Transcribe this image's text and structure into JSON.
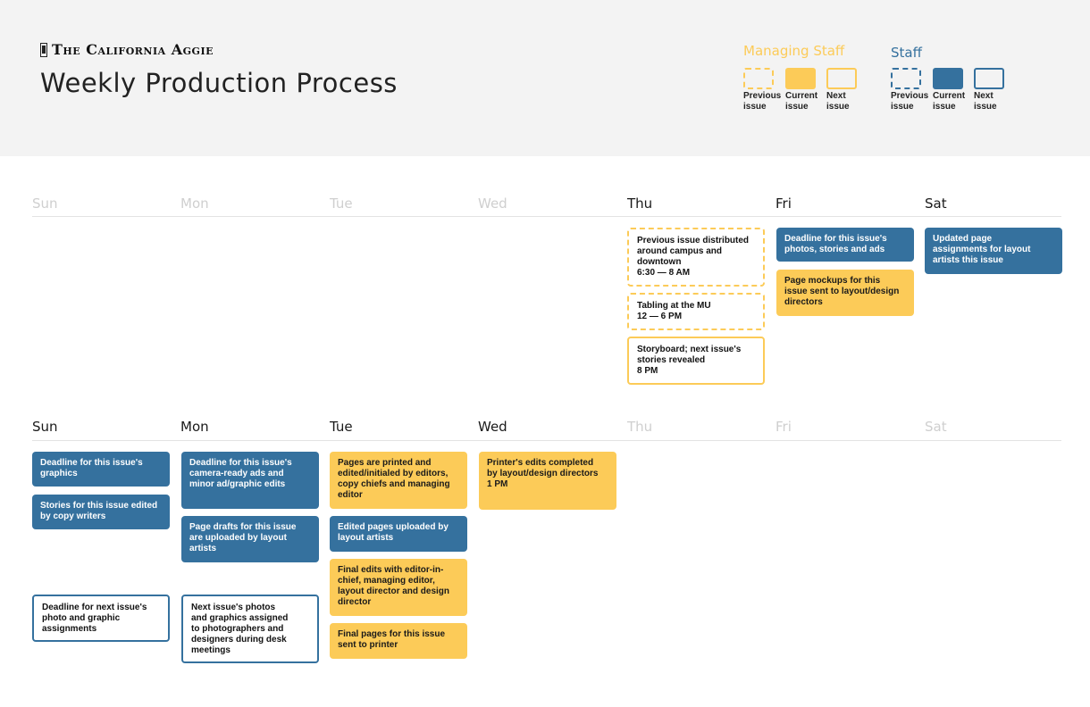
{
  "header": {
    "publication": "The California Aggie",
    "title": "Weekly Production Process"
  },
  "legend": {
    "managing": {
      "title": "Managing Staff",
      "color": "#fccb58",
      "items": [
        "Previous\nissue",
        "Current\nissue",
        "Next\nissue"
      ]
    },
    "staff": {
      "title": "Staff",
      "color": "#35719e",
      "items": [
        "Previous\nissue",
        "Current\nissue",
        "Next\nissue"
      ]
    }
  },
  "weeks": [
    {
      "days": [
        {
          "label": "Sun",
          "active": false
        },
        {
          "label": "Mon",
          "active": false
        },
        {
          "label": "Tue",
          "active": false
        },
        {
          "label": "Wed",
          "active": false
        },
        {
          "label": "Thu",
          "active": true
        },
        {
          "label": "Fri",
          "active": true
        },
        {
          "label": "Sat",
          "active": true
        }
      ]
    },
    {
      "days": [
        {
          "label": "Sun",
          "active": true
        },
        {
          "label": "Mon",
          "active": true
        },
        {
          "label": "Tue",
          "active": true
        },
        {
          "label": "Wed",
          "active": true
        },
        {
          "label": "Thu",
          "active": false
        },
        {
          "label": "Fri",
          "active": false
        },
        {
          "label": "Sat",
          "active": false
        }
      ]
    }
  ],
  "tasks": {
    "thu_1": "Previous issue distributed\naround campus and\ndowntown\n6:30 — 8 AM",
    "thu_2": "Tabling at the MU\n12 — 6 PM",
    "thu_3": "Storyboard; next issue's\nstories revealed\n8 PM",
    "fri_1": "Deadline for this issue's\nphotos, stories and ads",
    "fri_2": "Page mockups for this\nissue sent to layout/design\ndirectors",
    "sat_1": "Updated page\nassignments for layout\nartists this issue",
    "sun_1": "Deadline for this issue's\ngraphics",
    "sun_2": "Stories for this issue edited\nby copy writers",
    "sun_3": "Deadline for next issue's\nphoto and graphic\nassignments",
    "mon_1": "Deadline for this issue's\ncamera-ready ads and\nminor ad/graphic edits",
    "mon_2": "Page drafts for this issue\nare uploaded by layout\nartists",
    "mon_3": "Next issue's photos\nand graphics assigned\nto photographers and\ndesigners during desk\nmeetings",
    "tue_1": "Pages are printed and\nedited/initialed by editors,\ncopy chiefs and managing\neditor",
    "tue_2": "Edited pages uploaded by\nlayout artists",
    "tue_3": "Final edits with editor-in-\nchief, managing editor,\nlayout director and design\ndirector",
    "tue_4": "Final pages for this issue\nsent to printer",
    "wed_1": "Printer's edits completed\nby layout/design directors\n1 PM"
  }
}
